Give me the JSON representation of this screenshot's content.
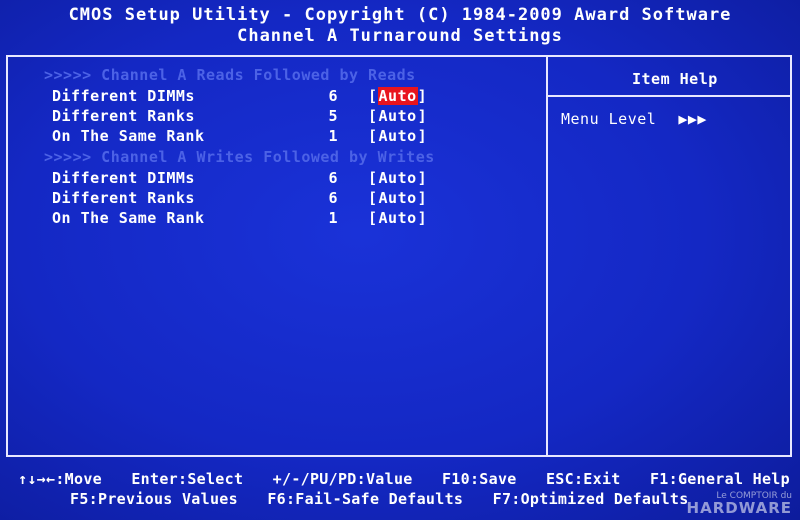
{
  "header": {
    "title": "CMOS Setup Utility - Copyright (C) 1984-2009 Award Software",
    "subtitle": "Channel A Turnaround Settings"
  },
  "sections": [
    {
      "header": ">>>>>  Channel A Reads Followed by Reads",
      "rows": [
        {
          "label": "Different DIMMs",
          "number": "6",
          "value": "Auto",
          "selected": true
        },
        {
          "label": "Different Ranks",
          "number": "5",
          "value": "Auto",
          "selected": false
        },
        {
          "label": "On The Same Rank",
          "number": "1",
          "value": "Auto",
          "selected": false
        }
      ]
    },
    {
      "header": ">>>>>  Channel A Writes Followed by Writes",
      "rows": [
        {
          "label": "Different DIMMs",
          "number": "6",
          "value": "Auto",
          "selected": false
        },
        {
          "label": "Different Ranks",
          "number": "6",
          "value": "Auto",
          "selected": false
        },
        {
          "label": "On The Same Rank",
          "number": "1",
          "value": "Auto",
          "selected": false
        }
      ]
    }
  ],
  "help": {
    "title": "Item Help",
    "menu_level_label": "Menu Level",
    "menu_level_arrows": "▶▶▶"
  },
  "footer": {
    "line1": [
      "↑↓→←:Move",
      "Enter:Select",
      "+/-/PU/PD:Value",
      "F10:Save",
      "ESC:Exit",
      "F1:General Help"
    ],
    "line2": [
      "F5:Previous Values",
      "F6:Fail-Safe Defaults",
      "F7:Optimized Defaults"
    ]
  },
  "watermark": {
    "small": "Le COMPTOIR du",
    "big": "HARDWARE"
  },
  "colors": {
    "background": "#1428c4",
    "selected_highlight": "#e8141e",
    "section_header": "#4c62e6",
    "text": "#ffffff"
  }
}
